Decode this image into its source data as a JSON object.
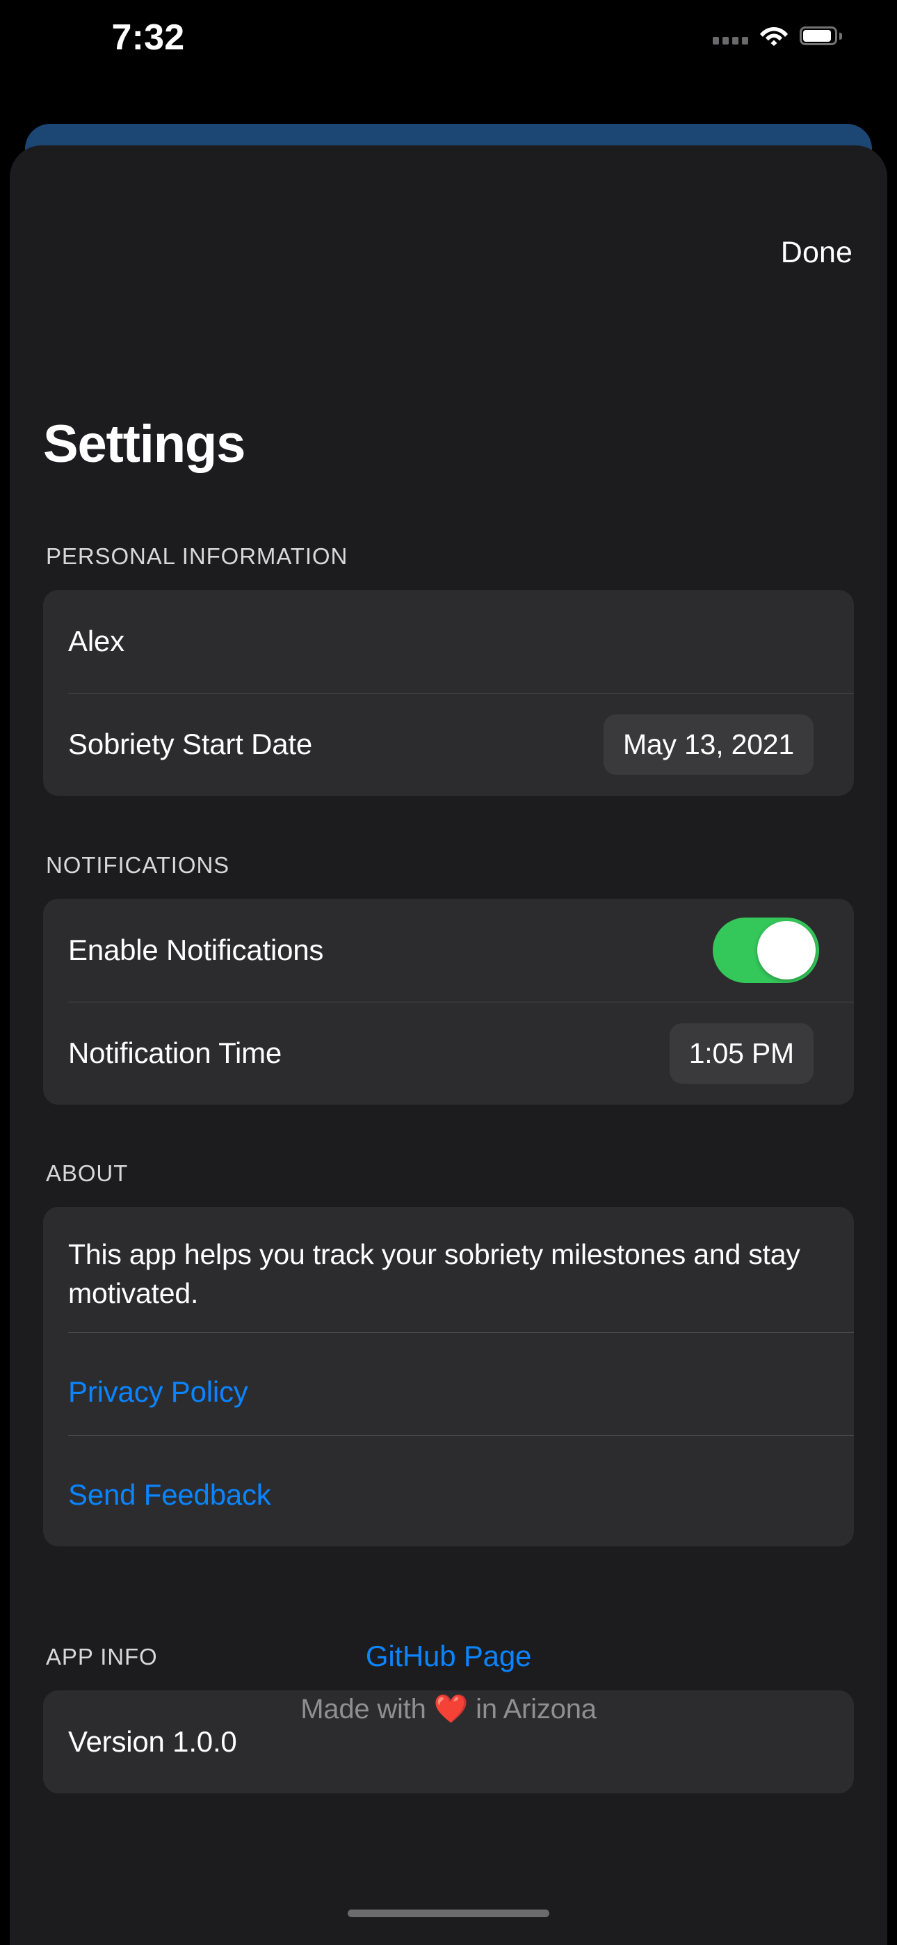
{
  "status_bar": {
    "time": "7:32",
    "signal_icon": "signal-dots-icon",
    "wifi_icon": "wifi-icon",
    "battery_icon": "battery-icon"
  },
  "sheet": {
    "done_label": "Done",
    "title": "Settings"
  },
  "sections": {
    "personal": {
      "header": "PERSONAL INFORMATION",
      "name_label": "Alex",
      "date_label": "Sobriety Start Date",
      "date_value": "May 13, 2021"
    },
    "notifications": {
      "header": "NOTIFICATIONS",
      "enable_label": "Enable Notifications",
      "enable_state": "on",
      "time_label": "Notification Time",
      "time_value": "1:05 PM"
    },
    "about": {
      "header": "ABOUT",
      "description": "This app helps you track your sobriety milestones and stay motivated.",
      "privacy_label": "Privacy Policy",
      "feedback_label": "Send Feedback"
    },
    "app_info": {
      "header": "APP INFO",
      "version_label": "Version 1.0.0"
    }
  },
  "footer": {
    "github_label": "GitHub Page",
    "made_with_prefix": "Made with ",
    "heart": "❤️",
    "made_with_suffix": " in Arizona"
  },
  "colors": {
    "accent_blue": "#0A84FF",
    "toggle_green": "#34C759",
    "sheet_background": "#1C1C1E",
    "card_background": "#2C2C2E",
    "pill_background": "#3A3A3C",
    "behind_card_blue": "#1C4674"
  }
}
